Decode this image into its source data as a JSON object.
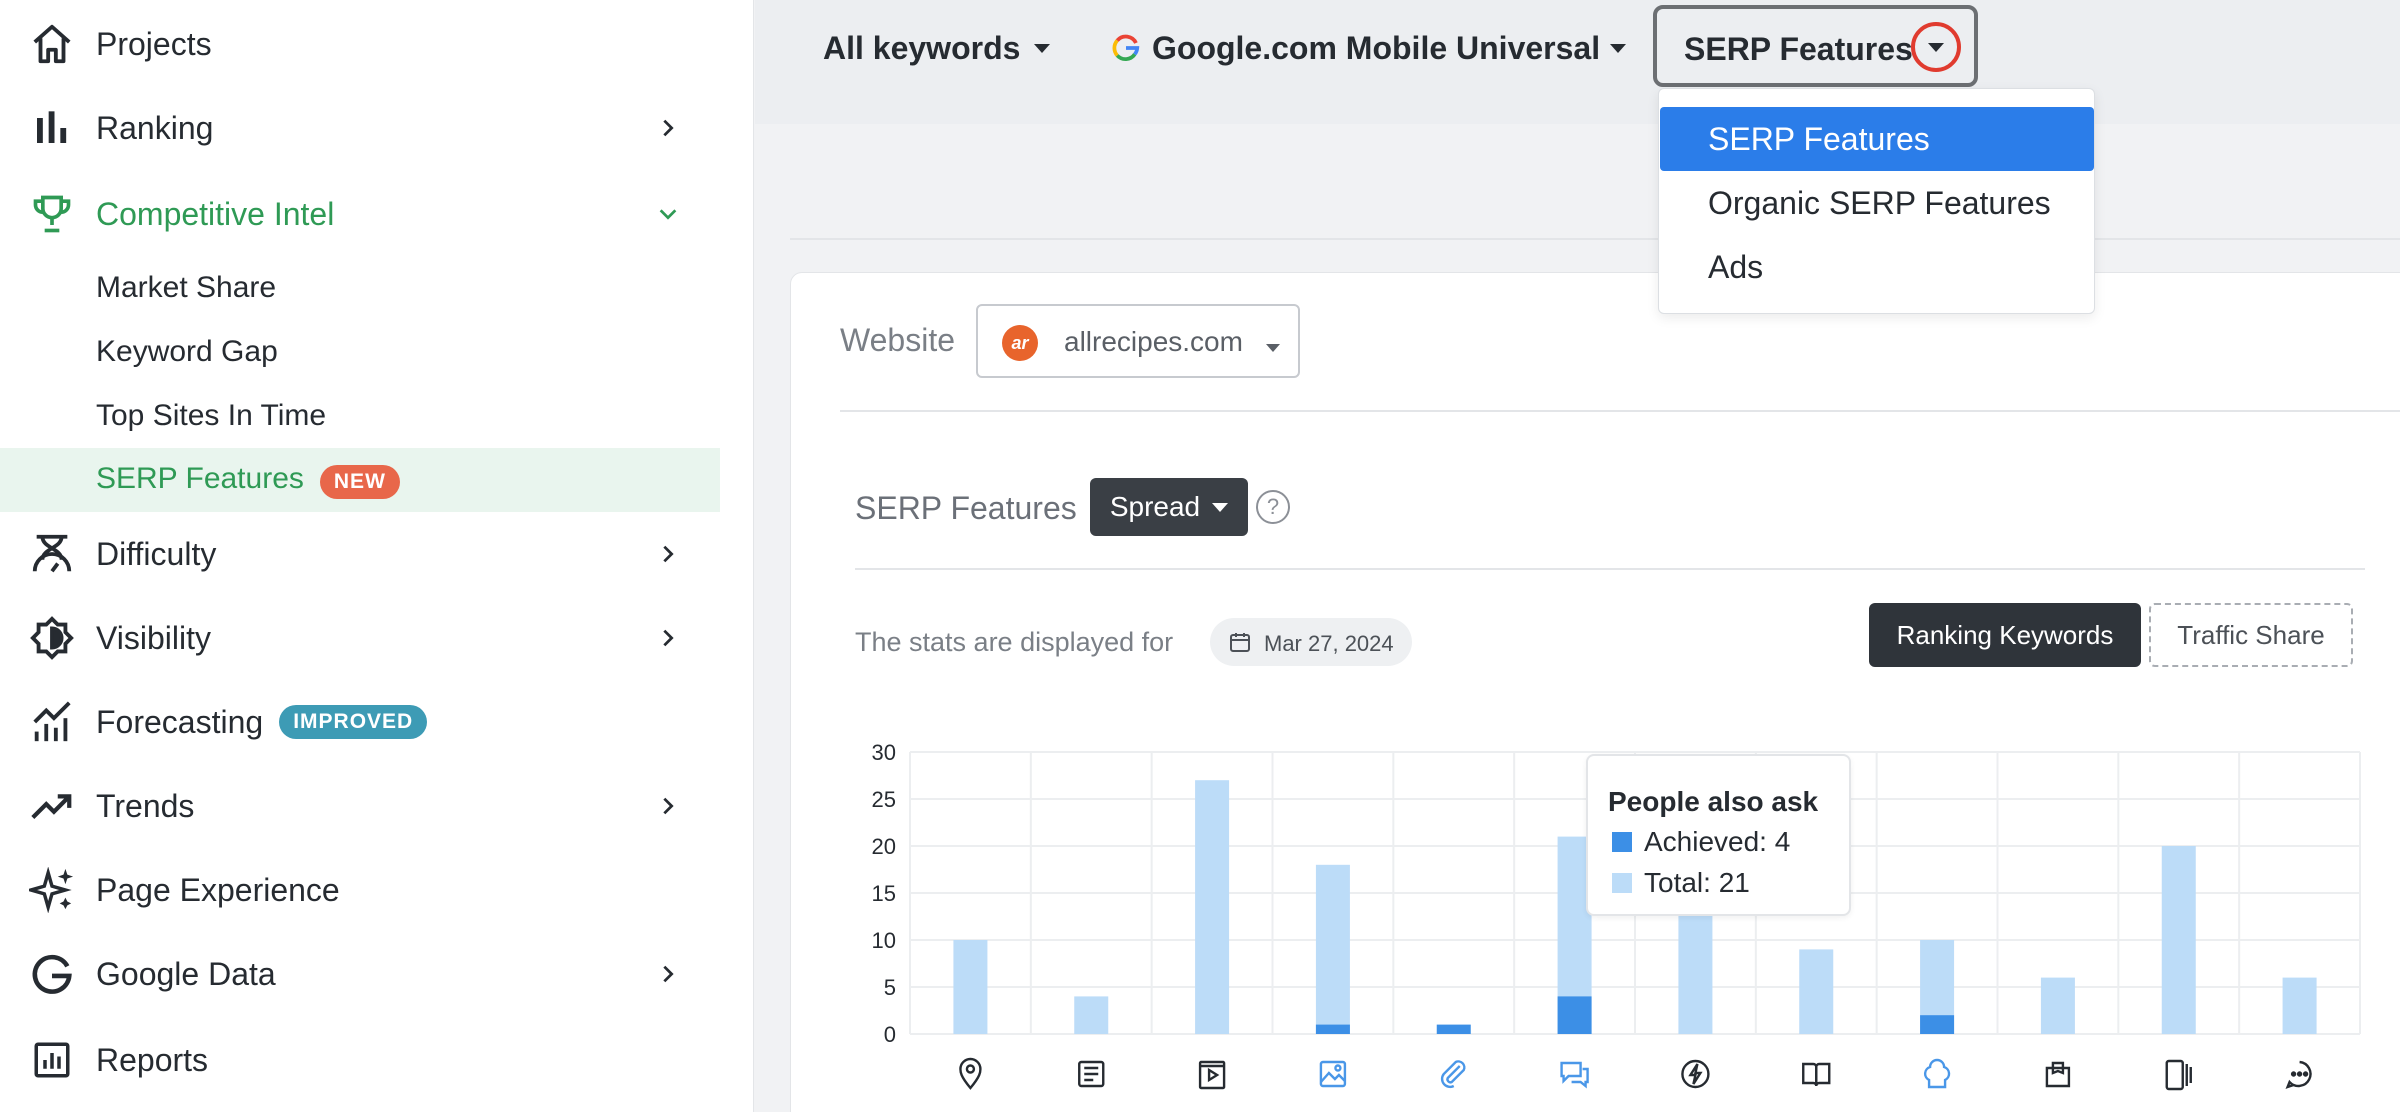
{
  "sidebar": {
    "items": [
      {
        "label": "Projects",
        "icon": "home-icon"
      },
      {
        "label": "Ranking",
        "icon": "bar-chart-icon"
      },
      {
        "label": "Competitive Intel",
        "icon": "trophy-icon"
      },
      {
        "label": "Difficulty",
        "icon": "difficulty-icon"
      },
      {
        "label": "Visibility",
        "icon": "visibility-icon"
      },
      {
        "label": "Forecasting",
        "icon": "forecasting-icon",
        "badge": "IMPROVED"
      },
      {
        "label": "Trends",
        "icon": "trend-line-icon"
      },
      {
        "label": "Page Experience",
        "icon": "sparkles-icon"
      },
      {
        "label": "Google Data",
        "icon": "google-icon"
      },
      {
        "label": "Reports",
        "icon": "reports-icon"
      }
    ],
    "sub_items": [
      {
        "label": "Market Share"
      },
      {
        "label": "Keyword Gap"
      },
      {
        "label": "Top Sites In Time"
      },
      {
        "label": "SERP Features",
        "badge": "NEW"
      }
    ]
  },
  "filters": {
    "keywords": "All keywords",
    "engine": "Google.com Mobile Universal",
    "serp": "SERP Features"
  },
  "dropdown": {
    "options": [
      "SERP Features",
      "Organic SERP Features",
      "Ads"
    ],
    "selected": "SERP Features"
  },
  "website": {
    "label": "Website",
    "value": "allrecipes.com",
    "logo_text": "ar"
  },
  "section": {
    "title": "SERP Features",
    "mode": "Spread",
    "help": "?"
  },
  "stats": {
    "text": "The stats are displayed for",
    "date": "Mar 27, 2024"
  },
  "toggles": {
    "ranking": "Ranking Keywords",
    "traffic": "Traffic Share"
  },
  "tooltip": {
    "title": "People also ask",
    "achieved": "Achieved: 4",
    "total": "Total: 21"
  },
  "colors": {
    "accent_green": "#2f9a55",
    "badge_new": "#e8674a",
    "badge_improved": "#3d9bb5",
    "dropdown_active": "#2b7de9",
    "bar_total": "#bcdcf8",
    "bar_achieved": "#3c8fe6",
    "highlight_red": "#e03b2f"
  },
  "chart_data": {
    "type": "bar",
    "ylim": [
      0,
      30
    ],
    "yticks": [
      0,
      5,
      10,
      15,
      20,
      25,
      30
    ],
    "categories": [
      "local-pack-icon",
      "news-icon",
      "video-icon",
      "images-icon",
      "sitelinks-icon",
      "people-also-ask-icon",
      "amp-icon",
      "knowledge-panel-icon",
      "recipes-icon",
      "shopping-icon",
      "mobile-icon",
      "reviews-icon"
    ],
    "series": [
      {
        "name": "Total",
        "values": [
          10,
          4,
          27,
          18,
          0,
          21,
          13,
          9,
          10,
          6,
          20,
          6
        ]
      },
      {
        "name": "Achieved",
        "values": [
          0,
          0,
          0,
          1,
          1,
          4,
          0,
          0,
          2,
          0,
          0,
          0
        ]
      }
    ],
    "highlighted_icons": [
      3,
      4,
      5,
      8
    ]
  }
}
